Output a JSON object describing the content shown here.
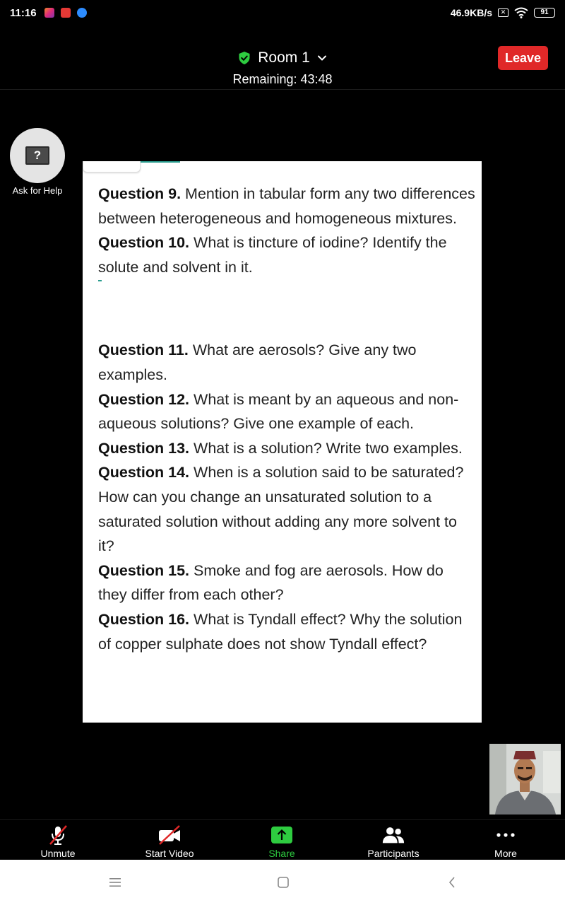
{
  "status_bar": {
    "time": "11:16",
    "network_speed": "46.9KB/s",
    "x_badge": "✕",
    "battery": "91"
  },
  "meeting": {
    "room_name": "Room 1",
    "remaining": "Remaining: 43:48",
    "leave_label": "Leave",
    "accent_green": "#2ecc40",
    "leave_color": "#e02828"
  },
  "help": {
    "icon_glyph": "?",
    "label": "Ask for Help"
  },
  "document": {
    "q9": {
      "label": "Question 9.",
      "text": "  Mention in tabular form any two differences between heterogeneous and homogeneous mixtures."
    },
    "q10": {
      "label": "Question 10.",
      "text": " What is tincture of iodine? Identify the solute and solvent in it."
    },
    "q11": {
      "label": "Question 11.",
      "text": " What are aerosols? Give any two examples."
    },
    "q12": {
      "label": "Question 12.",
      "text": " What is meant by an aqueous and non-aqueous solutions? Give one example of each."
    },
    "q13": {
      "label": "Question 13.",
      "text": " What is a solution? Write two examples."
    },
    "q14": {
      "label": "Question 14.",
      "text": " When is a solution said to be saturated? How can you change an unsaturated solution to a saturated solution without adding any more solvent to it?"
    },
    "q15": {
      "label": "Question 15.",
      "text": "  Smoke and fog are aerosols. How do they differ from each other?"
    },
    "q16": {
      "label": "Question 16.",
      "text": " What is Tyndall effect? Why the solution of copper sulphate does not show Tyndall effect?"
    }
  },
  "toolbar": {
    "unmute": "Unmute",
    "start_video": "Start Video",
    "share": "Share",
    "participants": "Participants",
    "more": "More"
  }
}
